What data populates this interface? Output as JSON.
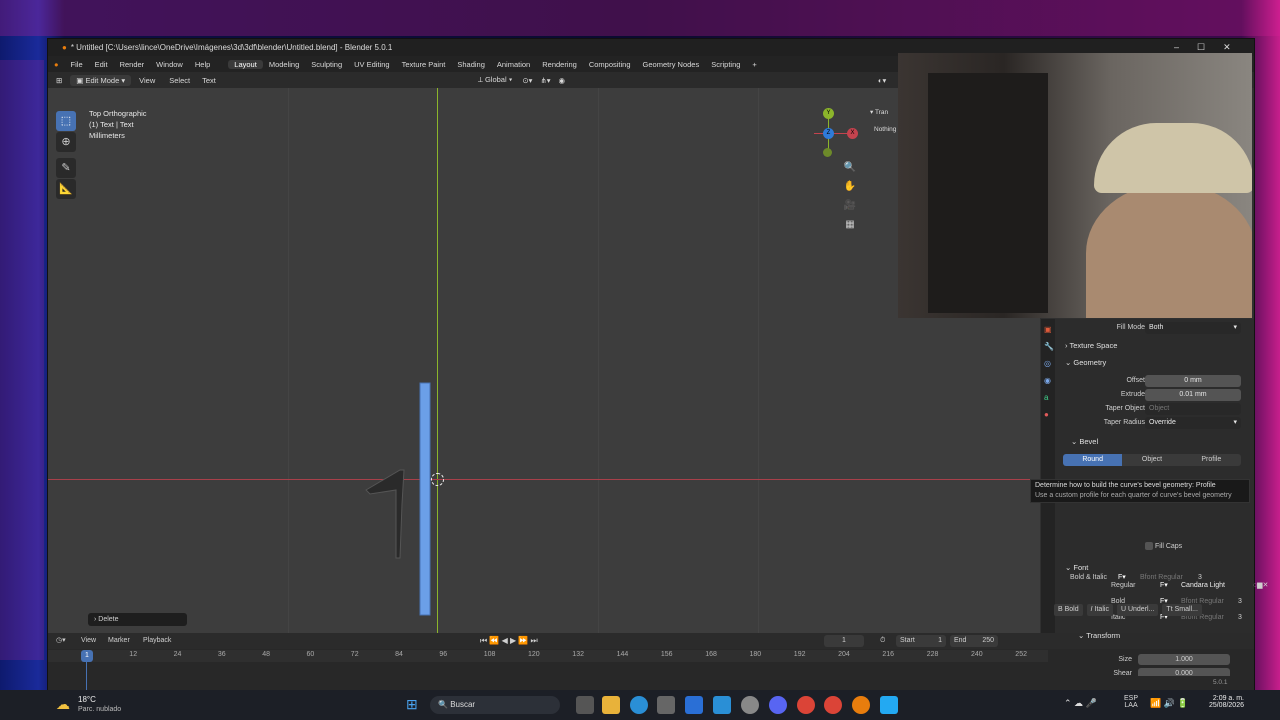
{
  "window_title": "* Untitled [C:\\Users\\lince\\OneDrive\\Imágenes\\3d\\3df\\blender\\Untitled.blend] - Blender 5.0.1",
  "menu": [
    "File",
    "Edit",
    "Render",
    "Window",
    "Help"
  ],
  "workspaces": [
    "Layout",
    "Modeling",
    "Sculpting",
    "UV Editing",
    "Texture Paint",
    "Shading",
    "Animation",
    "Rendering",
    "Compositing",
    "Geometry Nodes",
    "Scripting"
  ],
  "active_workspace": "Layout",
  "add_workspace": "+",
  "header": {
    "mode": "Edit Mode",
    "view": "View",
    "select": "Select",
    "text": "Text",
    "transform_orientation": "Global"
  },
  "viewport": {
    "view_name": "Top Orthographic",
    "object_info": "(1) Text | Text",
    "units": "Millimeters",
    "last_op": "Delete",
    "sidebar_tab": "Tran",
    "sidebar_hint": "Nothing",
    "gizmo": {
      "x": "X",
      "y": "Y",
      "z": "Z"
    }
  },
  "properties": {
    "fill_mode_label": "Fill Mode",
    "fill_mode_value": "Both",
    "texture_space": "Texture Space",
    "geometry": "Geometry",
    "offset_label": "Offset",
    "offset_value": "0 mm",
    "extrude_label": "Extrude",
    "extrude_value": "0.01 mm",
    "taper_object_label": "Taper Object",
    "taper_object_placeholder": "Object",
    "taper_radius_label": "Taper Radius",
    "taper_radius_value": "Override",
    "bevel": "Bevel",
    "bevel_modes": [
      "Round",
      "Object",
      "Profile"
    ],
    "bevel_active": "Round",
    "fill_caps": "Fill Caps",
    "font": "Font",
    "fonts": [
      {
        "label": "Regular",
        "value": "Candara Light"
      },
      {
        "label": "Bold",
        "value": "Bfont Regular",
        "count": "3"
      },
      {
        "label": "Italic",
        "value": "Bfont Regular",
        "count": "3"
      },
      {
        "label": "Bold & Italic",
        "value": "Bfont Regular",
        "count": "3"
      }
    ],
    "style_buttons": [
      "Bold",
      "Italic",
      "Underl...",
      "Small..."
    ],
    "transform": "Transform",
    "size_label": "Size",
    "size_value": "1.000",
    "shear_label": "Shear",
    "shear_value": "0.000"
  },
  "tooltip": {
    "line1": "Determine how to build the curve's bevel geometry: Profile",
    "line2": "Use a custom profile for each quarter of curve's bevel geometry"
  },
  "timeline": {
    "view": "View",
    "marker": "Marker",
    "playback": "Playback",
    "current_frame": "1",
    "start_label": "Start",
    "start": "1",
    "end_label": "End",
    "end": "250",
    "ticks": [
      "1",
      "12",
      "24",
      "36",
      "48",
      "60",
      "72",
      "84",
      "96",
      "108",
      "120",
      "132",
      "144",
      "156",
      "168",
      "180",
      "192",
      "204",
      "216",
      "228",
      "240",
      "252"
    ]
  },
  "status_version": "5.0.1",
  "taskbar": {
    "weather_temp": "18°C",
    "weather_desc": "Parc. nublado",
    "search": "Buscar",
    "lang_top": "ESP",
    "lang_bottom": "LAA",
    "time": "2:09 a. m.",
    "date": "25/08/2026"
  },
  "colors": {
    "accent": "#4772b3",
    "x_axis": "#c4434e",
    "y_axis": "#8cb52b"
  }
}
